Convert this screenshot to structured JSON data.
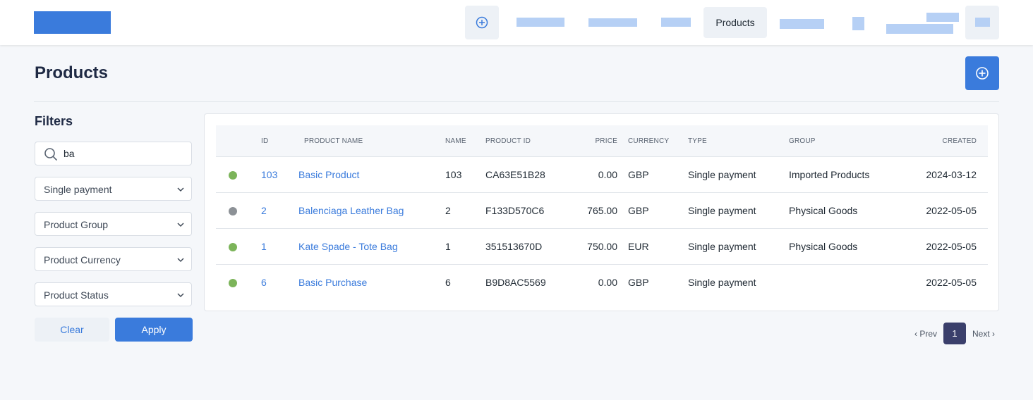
{
  "header": {
    "active_nav_label": "Products"
  },
  "page": {
    "title": "Products"
  },
  "filters": {
    "title": "Filters",
    "search_value": "ba",
    "selects": [
      {
        "label": "Single payment"
      },
      {
        "label": "Product Group"
      },
      {
        "label": "Product Currency"
      },
      {
        "label": "Product Status"
      }
    ],
    "clear_label": "Clear",
    "apply_label": "Apply"
  },
  "table": {
    "columns": [
      "ID",
      "PRODUCT NAME",
      "NAME",
      "PRODUCT ID",
      "PRICE",
      "CURRENCY",
      "TYPE",
      "GROUP",
      "CREATED"
    ],
    "rows": [
      {
        "status_color": "#7cb45a",
        "id": "103",
        "product_name": "Basic Product",
        "name": "103",
        "product_id": "CA63E51B28",
        "price": "0.00",
        "currency": "GBP",
        "type": "Single payment",
        "group": "Imported Products",
        "created": "2024-03-12"
      },
      {
        "status_color": "#8c9196",
        "id": "2",
        "product_name": "Balenciaga Leather Bag",
        "name": "2",
        "product_id": "F133D570C6",
        "price": "765.00",
        "currency": "GBP",
        "type": "Single payment",
        "group": "Physical Goods",
        "created": "2022-05-05"
      },
      {
        "status_color": "#7cb45a",
        "id": "1",
        "product_name": "Kate Spade - Tote Bag",
        "name": "1",
        "product_id": "351513670D",
        "price": "750.00",
        "currency": "EUR",
        "type": "Single payment",
        "group": "Physical Goods",
        "created": "2022-05-05"
      },
      {
        "status_color": "#7cb45a",
        "id": "6",
        "product_name": "Basic Purchase",
        "name": "6",
        "product_id": "B9D8AC5569",
        "price": "0.00",
        "currency": "GBP",
        "type": "Single payment",
        "group": "",
        "created": "2022-05-05"
      }
    ]
  },
  "pagination": {
    "prev_label": "‹ Prev",
    "current_page": "1",
    "next_label": "Next ›"
  },
  "colors": {
    "accent": "#3a7bdc",
    "status_active": "#7cb45a",
    "status_inactive": "#8c9196"
  },
  "icons": {
    "nav_add": "plus-circle-icon",
    "page_add": "plus-circle-icon",
    "search": "search-icon",
    "select": "chevron-down-icon"
  }
}
